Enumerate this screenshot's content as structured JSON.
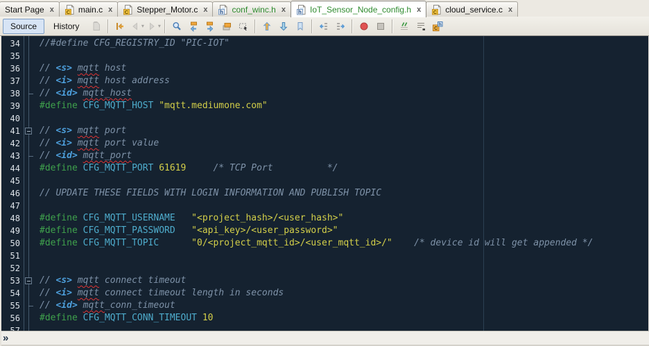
{
  "tabs": [
    {
      "label": "Start Page",
      "icon": "none",
      "active": false,
      "green": false,
      "close_label": "x"
    },
    {
      "label": "main.c",
      "icon": "c-file",
      "active": false,
      "green": false,
      "close_label": "x"
    },
    {
      "label": "Stepper_Motor.c",
      "icon": "c-file",
      "active": false,
      "green": false,
      "close_label": "x"
    },
    {
      "label": "conf_winc.h",
      "icon": "h-file",
      "active": false,
      "green": true,
      "close_label": "x"
    },
    {
      "label": "IoT_Sensor_Node_config.h",
      "icon": "h-file",
      "active": true,
      "green": true,
      "close_label": "x"
    },
    {
      "label": "cloud_service.c",
      "icon": "c-file",
      "active": false,
      "green": false,
      "close_label": "x"
    }
  ],
  "toolbar": {
    "items": [
      {
        "type": "toggle",
        "name": "source-button",
        "label": "Source",
        "pressed": true
      },
      {
        "type": "toggle",
        "name": "history-button",
        "label": "History",
        "pressed": false
      },
      {
        "type": "icon",
        "name": "last-edited-icon",
        "glyph": "doc",
        "disabled": true
      },
      {
        "type": "sep"
      },
      {
        "type": "icon",
        "name": "back-to-last-edit-icon",
        "glyph": "jumpback",
        "disabled": false
      },
      {
        "type": "icon",
        "name": "back-icon",
        "glyph": "back",
        "disabled": true,
        "dropdown": true
      },
      {
        "type": "icon",
        "name": "forward-icon",
        "glyph": "forward",
        "disabled": true,
        "dropdown": true
      },
      {
        "type": "sep"
      },
      {
        "type": "icon",
        "name": "find-selection-icon",
        "glyph": "find",
        "disabled": false
      },
      {
        "type": "icon",
        "name": "find-previous-icon",
        "glyph": "findprev",
        "disabled": false
      },
      {
        "type": "icon",
        "name": "find-next-icon",
        "glyph": "findnext",
        "disabled": false
      },
      {
        "type": "icon",
        "name": "toggle-highlight-icon",
        "glyph": "highlight",
        "disabled": false
      },
      {
        "type": "icon",
        "name": "rectangular-selection-icon",
        "glyph": "rectsel",
        "disabled": false
      },
      {
        "type": "sep"
      },
      {
        "type": "icon",
        "name": "previous-bookmark-icon",
        "glyph": "bmup",
        "disabled": false
      },
      {
        "type": "icon",
        "name": "next-bookmark-icon",
        "glyph": "bmdown",
        "disabled": false
      },
      {
        "type": "icon",
        "name": "toggle-bookmark-icon",
        "glyph": "bookmark",
        "disabled": false
      },
      {
        "type": "sep"
      },
      {
        "type": "icon",
        "name": "shift-line-left-icon",
        "glyph": "shiftleft",
        "disabled": false
      },
      {
        "type": "icon",
        "name": "shift-line-right-icon",
        "glyph": "shiftright",
        "disabled": false
      },
      {
        "type": "sep"
      },
      {
        "type": "icon",
        "name": "start-macro-recording-icon",
        "glyph": "record",
        "disabled": false
      },
      {
        "type": "icon",
        "name": "stop-macro-recording-icon",
        "glyph": "stop",
        "disabled": false
      },
      {
        "type": "sep"
      },
      {
        "type": "icon",
        "name": "comment-icon",
        "glyph": "comment",
        "disabled": false
      },
      {
        "type": "icon",
        "name": "uncomment-icon",
        "glyph": "uncomment",
        "disabled": false
      },
      {
        "type": "icon",
        "name": "toggle-header-source-icon",
        "glyph": "headersrc",
        "disabled": false
      }
    ]
  },
  "editor": {
    "colors": {
      "background": "#152230",
      "comment": "#7E92A8",
      "doc_tag": "#4D9FDC",
      "directive": "#3FA24C",
      "macro_name": "#4EACCC",
      "string": "#D3CF49",
      "number": "#D3CF49",
      "line_number": "#DDE3E9",
      "spell_squiggle": "#E03434",
      "margin_guide": "#2B3F52"
    },
    "lines": [
      {
        "num": "34",
        "fold": "",
        "segs": [
          [
            "cm",
            "//#define CFG_REGISTRY_ID \"PIC-IOT\""
          ]
        ]
      },
      {
        "num": "35",
        "fold": "",
        "segs": []
      },
      {
        "num": "36",
        "fold": "",
        "segs": [
          [
            "cm",
            "// "
          ],
          [
            "tg",
            "<s>"
          ],
          [
            "cm",
            " "
          ],
          [
            "cs",
            "mqtt"
          ],
          [
            "cm",
            " host"
          ]
        ]
      },
      {
        "num": "37",
        "fold": "",
        "segs": [
          [
            "cm",
            "// "
          ],
          [
            "tg",
            "<i>"
          ],
          [
            "cm",
            " "
          ],
          [
            "cs",
            "mqtt"
          ],
          [
            "cm",
            " host address"
          ]
        ]
      },
      {
        "num": "38",
        "fold": "end",
        "segs": [
          [
            "cm",
            "// "
          ],
          [
            "tg",
            "<id>"
          ],
          [
            "cm",
            " "
          ],
          [
            "cs",
            "mqtt_host"
          ]
        ]
      },
      {
        "num": "39",
        "fold": "",
        "segs": [
          [
            "di",
            "#define"
          ],
          [
            "pl",
            " "
          ],
          [
            "mn",
            "CFG_MQTT_HOST"
          ],
          [
            "pl",
            " "
          ],
          [
            "st",
            "\"mqtt.mediumone.com\""
          ]
        ]
      },
      {
        "num": "40",
        "fold": "",
        "segs": []
      },
      {
        "num": "41",
        "fold": "box",
        "segs": [
          [
            "cm",
            "// "
          ],
          [
            "tg",
            "<s>"
          ],
          [
            "cm",
            " "
          ],
          [
            "cs",
            "mqtt"
          ],
          [
            "cm",
            " port"
          ]
        ]
      },
      {
        "num": "42",
        "fold": "",
        "segs": [
          [
            "cm",
            "// "
          ],
          [
            "tg",
            "<i>"
          ],
          [
            "cm",
            " "
          ],
          [
            "cs",
            "mqtt"
          ],
          [
            "cm",
            " port value"
          ]
        ]
      },
      {
        "num": "43",
        "fold": "end",
        "segs": [
          [
            "cm",
            "// "
          ],
          [
            "tg",
            "<id>"
          ],
          [
            "cm",
            " "
          ],
          [
            "cs",
            "mqtt_port"
          ]
        ]
      },
      {
        "num": "44",
        "fold": "",
        "segs": [
          [
            "di",
            "#define"
          ],
          [
            "pl",
            " "
          ],
          [
            "mn",
            "CFG_MQTT_PORT"
          ],
          [
            "pl",
            " "
          ],
          [
            "nm",
            "61619"
          ],
          [
            "pl",
            "     "
          ],
          [
            "cm",
            "/* TCP Port          */"
          ]
        ]
      },
      {
        "num": "45",
        "fold": "",
        "segs": []
      },
      {
        "num": "46",
        "fold": "",
        "segs": [
          [
            "cm",
            "// UPDATE THESE FIELDS WITH LOGIN INFORMATION AND PUBLISH TOPIC"
          ]
        ]
      },
      {
        "num": "47",
        "fold": "",
        "segs": []
      },
      {
        "num": "48",
        "fold": "",
        "segs": [
          [
            "di",
            "#define"
          ],
          [
            "pl",
            " "
          ],
          [
            "mn",
            "CFG_MQTT_USERNAME"
          ],
          [
            "pl",
            "   "
          ],
          [
            "st",
            "\"<project_hash>/<user_hash>\""
          ]
        ]
      },
      {
        "num": "49",
        "fold": "",
        "segs": [
          [
            "di",
            "#define"
          ],
          [
            "pl",
            " "
          ],
          [
            "mn",
            "CFG_MQTT_PASSWORD"
          ],
          [
            "pl",
            "   "
          ],
          [
            "st",
            "\"<api_key>/<user_password>\""
          ]
        ]
      },
      {
        "num": "50",
        "fold": "",
        "segs": [
          [
            "di",
            "#define"
          ],
          [
            "pl",
            " "
          ],
          [
            "mn",
            "CFG_MQTT_TOPIC"
          ],
          [
            "pl",
            "      "
          ],
          [
            "st",
            "\"0/<project_mqtt_id>/<user_mqtt_id>/\""
          ],
          [
            "pl",
            "    "
          ],
          [
            "cm",
            "/* device id will get appended */"
          ]
        ]
      },
      {
        "num": "51",
        "fold": "",
        "segs": []
      },
      {
        "num": "52",
        "fold": "",
        "segs": []
      },
      {
        "num": "53",
        "fold": "box",
        "segs": [
          [
            "cm",
            "// "
          ],
          [
            "tg",
            "<s>"
          ],
          [
            "cm",
            " "
          ],
          [
            "cs",
            "mqtt"
          ],
          [
            "cm",
            " connect timeout"
          ]
        ]
      },
      {
        "num": "54",
        "fold": "",
        "segs": [
          [
            "cm",
            "// "
          ],
          [
            "tg",
            "<i>"
          ],
          [
            "cm",
            " "
          ],
          [
            "cs",
            "mqtt"
          ],
          [
            "cm",
            " connect timeout length in seconds"
          ]
        ]
      },
      {
        "num": "55",
        "fold": "end",
        "segs": [
          [
            "cm",
            "// "
          ],
          [
            "tg",
            "<id>"
          ],
          [
            "cm",
            " "
          ],
          [
            "cs",
            "mqtt"
          ],
          [
            "cm",
            "_conn_timeout"
          ]
        ]
      },
      {
        "num": "56",
        "fold": "",
        "segs": [
          [
            "di",
            "#define"
          ],
          [
            "pl",
            " "
          ],
          [
            "mn",
            "CFG_MQTT_CONN_TIMEOUT"
          ],
          [
            "pl",
            " "
          ],
          [
            "nm",
            "10"
          ]
        ]
      },
      {
        "num": "57",
        "fold": "",
        "segs": []
      }
    ]
  },
  "breadcrumb": {
    "chevron": "»"
  }
}
